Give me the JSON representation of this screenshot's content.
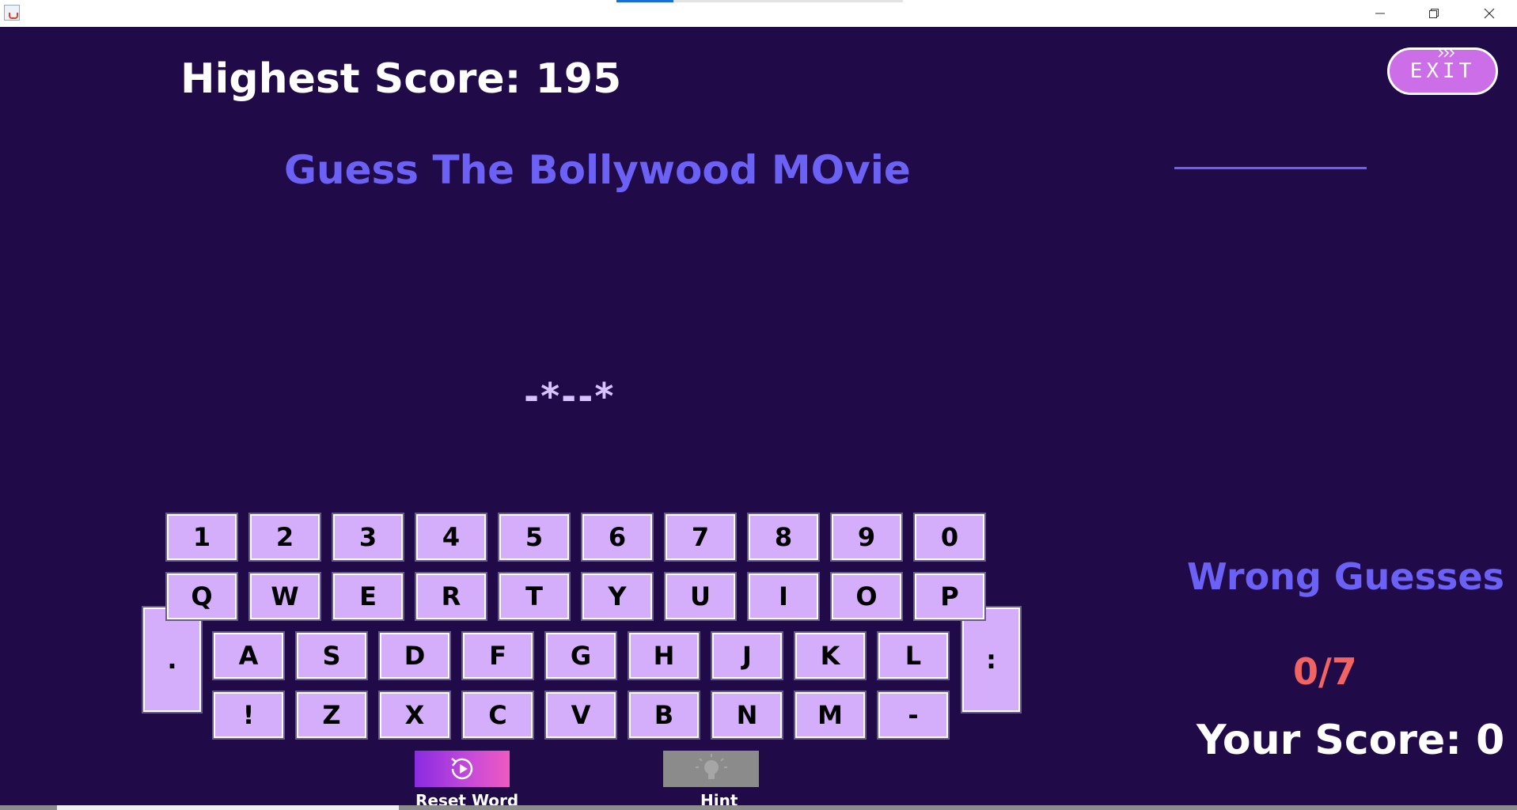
{
  "window": {
    "app_icon": "java-icon",
    "controls": [
      "minimize-icon",
      "restore-icon",
      "close-icon"
    ]
  },
  "header": {
    "highest_score": "Highest Score: 195",
    "title": "Guess The Bollywood MOvie",
    "exit_label": "EXIT"
  },
  "game": {
    "masked_word": "-*--*"
  },
  "keyboard": {
    "row_numbers": [
      "1",
      "2",
      "3",
      "4",
      "5",
      "6",
      "7",
      "8",
      "9",
      "0"
    ],
    "row_top": [
      "Q",
      "W",
      "E",
      "R",
      "T",
      "Y",
      "U",
      "I",
      "O",
      "P"
    ],
    "row_home": [
      "A",
      "S",
      "D",
      "F",
      "G",
      "H",
      "J",
      "K",
      "L"
    ],
    "row_bottom": [
      "!",
      "Z",
      "X",
      "C",
      "V",
      "B",
      "N",
      "M",
      "-"
    ],
    "left_tall_key": ".",
    "right_tall_key": ":"
  },
  "actions": {
    "reset_label": "Reset Word",
    "reset_icon": "replay-icon",
    "hint_label": "Hint",
    "hint_icon": "lightbulb-icon"
  },
  "stats": {
    "wrong_title": "Wrong Guesses",
    "wrong_count": "0/7",
    "your_score": "Your Score: 0"
  },
  "colors": {
    "background": "#200a48",
    "accent": "#6b62f5",
    "key_fill": "#d4aefb",
    "wrong_count": "#f26464",
    "exit_button": "#cc6ee8"
  }
}
